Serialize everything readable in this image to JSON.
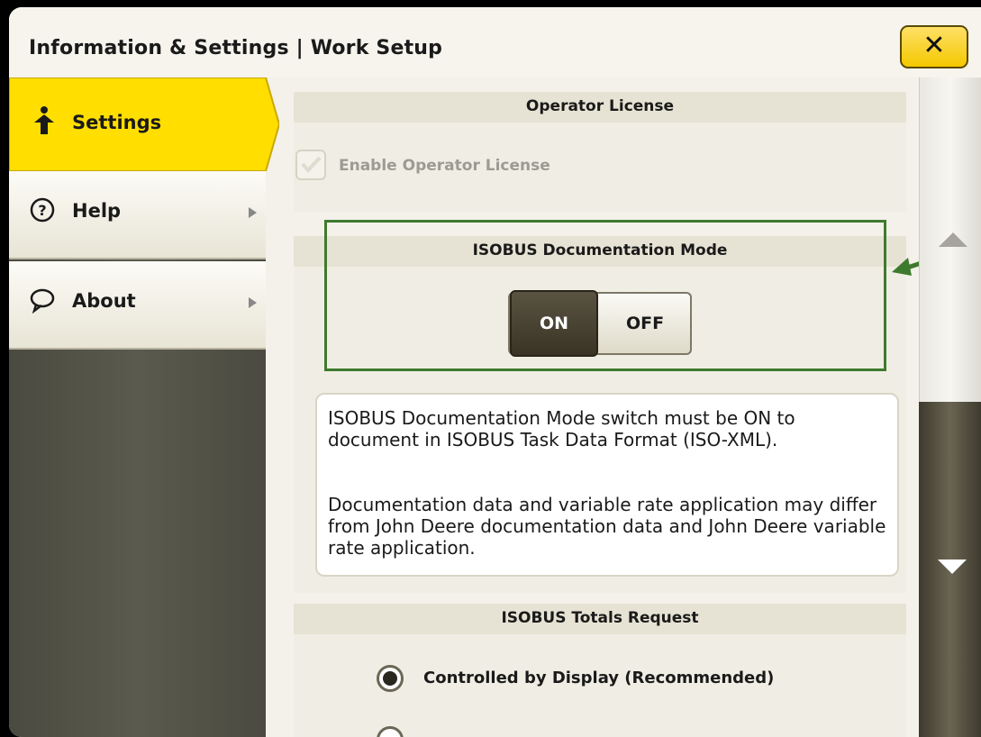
{
  "window": {
    "title": "Information & Settings | Work Setup",
    "close_label": "✕"
  },
  "sidebar": {
    "items": [
      {
        "label": "Settings",
        "icon": "person-up-icon",
        "selected": true
      },
      {
        "label": "Help",
        "icon": "help-circle-icon",
        "selected": false
      },
      {
        "label": "About",
        "icon": "speech-bubble-icon",
        "selected": false
      }
    ]
  },
  "main": {
    "operator_license": {
      "heading": "Operator License",
      "checkbox_label": "Enable Operator License",
      "checked": false,
      "disabled": true
    },
    "isobus_doc_mode": {
      "heading": "ISOBUS Documentation Mode",
      "on_label": "ON",
      "off_label": "OFF",
      "selected": "ON"
    },
    "info": {
      "paragraph1": "ISOBUS Documentation Mode switch must be ON to document in ISOBUS Task Data Format (ISO-XML).",
      "paragraph2": "Documentation data and variable rate application may differ from John Deere documentation data and John Deere variable rate application."
    },
    "isobus_totals": {
      "heading": "ISOBUS Totals Request",
      "option1_label": "Controlled by Display (Recommended)",
      "option1_selected": true
    }
  },
  "colors": {
    "accent_yellow": "#ffde00",
    "highlight_green": "#3e7a2e",
    "sidebar_dark": "#4f4f44"
  }
}
